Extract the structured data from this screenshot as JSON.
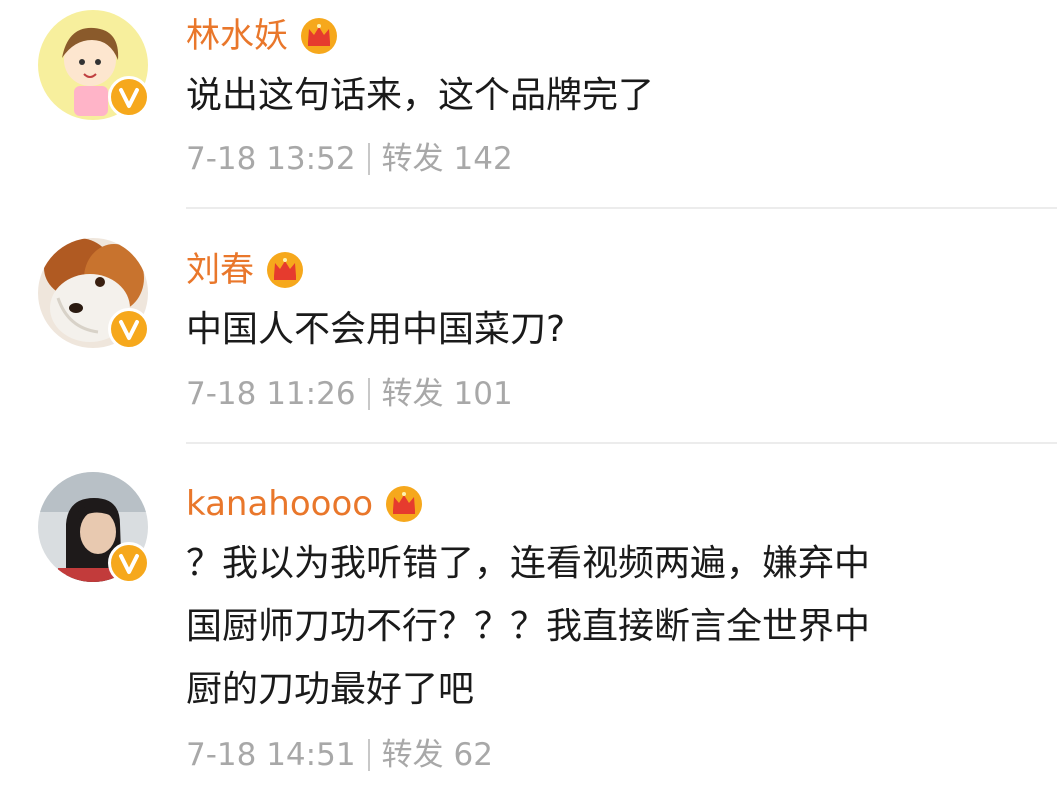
{
  "colors": {
    "username": "#e9772b",
    "content": "#1a1a1a",
    "meta": "#a8a8a8",
    "divider": "#ececec",
    "vip_badge": "#f6a81c"
  },
  "comments": [
    {
      "username": "林水妖",
      "avatar_icon": "cartoon-girl-avatar",
      "badge_icon": "verified-v-icon",
      "member_icon": "vip-crown-icon",
      "lines": [
        "说出这句话来，这个品牌完了"
      ],
      "time": "7-18 13:52",
      "repost_label": "转发",
      "repost_count": "142"
    },
    {
      "username": "刘春",
      "avatar_icon": "dog-avatar",
      "badge_icon": "verified-v-icon",
      "member_icon": "vip-crown-icon",
      "lines": [
        "中国人不会用中国菜刀?"
      ],
      "time": "7-18 11:26",
      "repost_label": "转发",
      "repost_count": "101"
    },
    {
      "username": "kanahoooo",
      "avatar_icon": "photo-person-avatar",
      "badge_icon": "verified-v-icon",
      "member_icon": "vip-crown-icon",
      "lines": [
        "？我以为我听错了，连看视频两遍，嫌弃中",
        "国厨师刀功不行？？？我直接断言全世界中",
        "厨的刀功最好了吧"
      ],
      "time": "7-18 14:51",
      "repost_label": "转发",
      "repost_count": "62"
    }
  ]
}
